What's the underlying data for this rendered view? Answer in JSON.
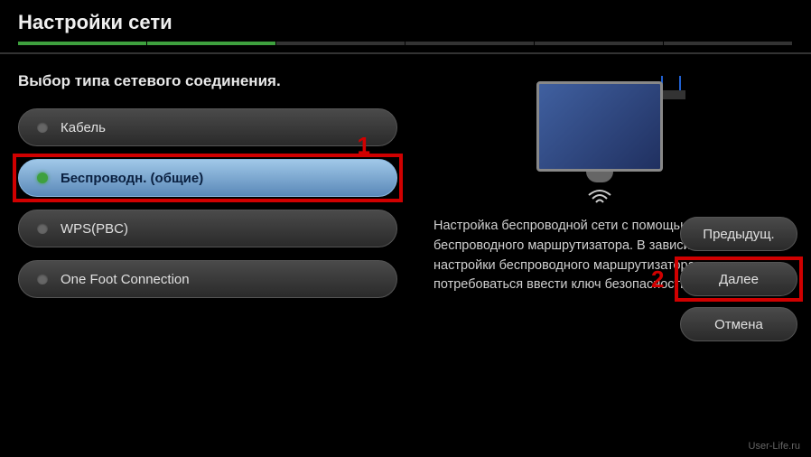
{
  "header": {
    "title": "Настройки сети"
  },
  "subtitle": "Выбор типа сетевого соединения.",
  "options": [
    {
      "label": "Кабель",
      "selected": false
    },
    {
      "label": "Беспроводн. (общие)",
      "selected": true
    },
    {
      "label": "WPS(PBC)",
      "selected": false
    },
    {
      "label": "One Foot Connection",
      "selected": false
    }
  ],
  "description": "Настройка беспроводной сети с помощью выбора беспроводного маршрутизатора. В зависимости от настройки беспроводного маршрутизатора может потребоваться ввести ключ безопасности.",
  "buttons": {
    "previous": "Предыдущ.",
    "next": "Далее",
    "cancel": "Отмена"
  },
  "annotations": {
    "marker1": "1",
    "marker2": "2"
  },
  "watermark": "User-Life.ru"
}
